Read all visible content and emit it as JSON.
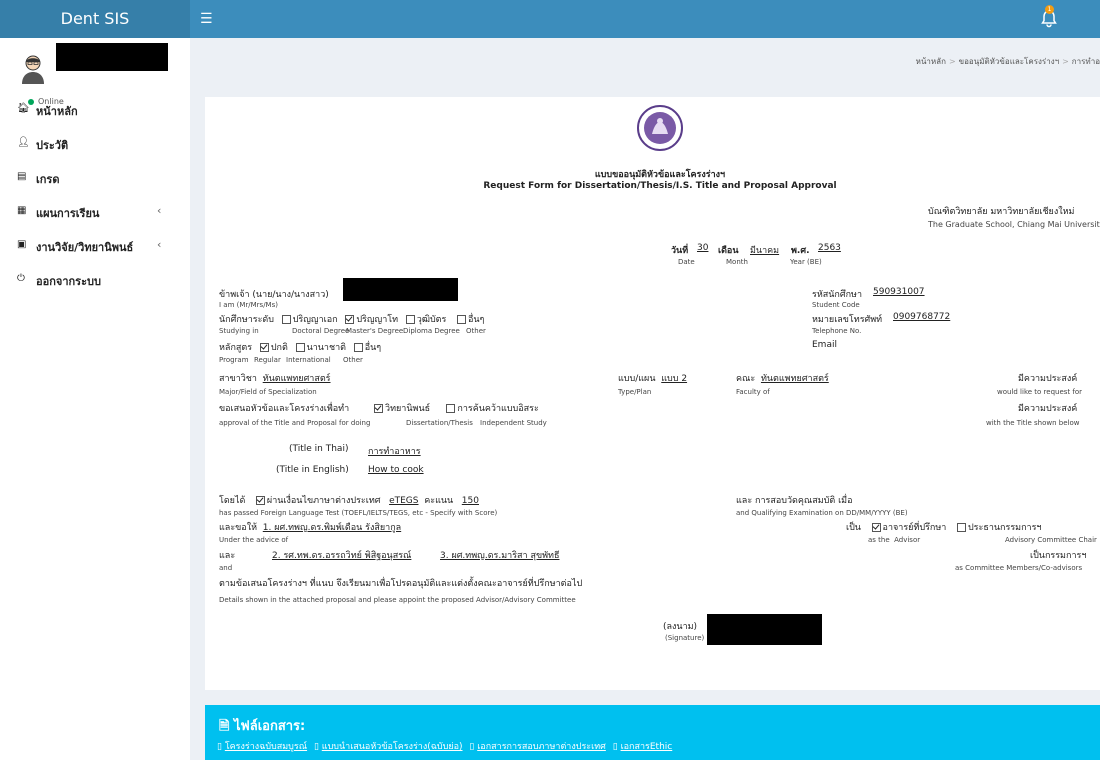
{
  "header": {
    "brand": "Dent SIS",
    "menu_icon": "menu-icon",
    "notification_count": "1"
  },
  "sidebar": {
    "status": "Online",
    "items": [
      {
        "icon": "home-icon",
        "label": "หน้าหลัก"
      },
      {
        "icon": "user-icon",
        "label": "ประวัติ"
      },
      {
        "icon": "grade-icon",
        "label": "เกรด"
      },
      {
        "icon": "calendar-icon",
        "label": "แผนการเรียน"
      },
      {
        "icon": "book-icon",
        "label": "งานวิจัย/วิทยานิพนธ์"
      },
      {
        "icon": "power-icon",
        "label": "ออกจากระบบ"
      }
    ]
  },
  "breadcrumb": {
    "home": "หน้าหลัก",
    "section": "ขออนุมัติหัวข้อและโครงร่างฯ",
    "current": "การทำอ"
  },
  "form": {
    "title_th": "แบบขออนุมัติหัวข้อและโครงร่างฯ",
    "title_en": "Request Form for Dissertation/Thesis/I.S. Title and Proposal Approval",
    "school_th": "บัณฑิตวิทยาลัย มหาวิทยาลัยเชียงใหม่",
    "school_en": "The Graduate School, Chiang Mai University",
    "date_lbl": "วันที่",
    "date_val": "30",
    "month_lbl": "เดือน",
    "month_val": "มีนาคม",
    "year_lbl": "พ.ศ.",
    "year_val": "2563",
    "date_en": "Date",
    "month_en": "Month",
    "year_en": "Year (BE)",
    "iam_th": "ข้าพเจ้า (นาย/นาง/นางสาว)",
    "iam_en": "I am (Mr/Mrs/Ms)",
    "student_code_th": "รหัสนักศึกษา",
    "student_code_val": "590931007",
    "student_code_en": "Student Code",
    "level_th": "นักศึกษาระดับ",
    "level_doc": "ปริญญาเอก",
    "level_master": "ปริญญาโท",
    "level_dip": "วุฒิบัตร",
    "level_other": "อื่นๆ",
    "level_en": "Studying in",
    "level_doc_en": "Doctoral Degree",
    "level_master_en": "Master's Degree",
    "level_dip_en": "Diploma Degree",
    "level_other_en": "Other",
    "phone_th": "หมายเลขโทรศัพท์",
    "phone_val": "0909768772",
    "phone_en": "Telephone No.",
    "email_en": "Email",
    "program_th": "หลักสูตร",
    "prog_regular": "ปกติ",
    "prog_inter": "นานาชาติ",
    "prog_other": "อื่นๆ",
    "program_en": "Program",
    "prog_regular_en": "Regular",
    "prog_inter_en": "International",
    "prog_other_en": "Other",
    "major_th": "สาขาวิชา",
    "major_val": "ทันตแพทยศาสตร์",
    "major_en": "Major/Field of Specialization",
    "plan_th": "แบบ/แผน",
    "plan_val": "แบบ 2",
    "plan_en": "Type/Plan",
    "faculty_th": "คณะ",
    "faculty_val": "ทันตแพทยศาสตร์",
    "faculty_en": "Faculty of",
    "wish_th": "มีความประสงค์",
    "wish_en": "would like to request for",
    "approve_th": "ขอเสนอหัวข้อและโครงร่างเพื่อทำ",
    "thesis_th": "วิทยานิพนธ์",
    "is_th": "การค้นคว้าแบบอิสระ",
    "approve_en": "approval of the Title and Proposal for doing",
    "thesis_en": "Dissertation/Thesis",
    "is_en": "Independent Study",
    "wish2_th": "มีความประสงค์",
    "wish2_en": "with the Title shown below",
    "title_thai_lbl": "(Title in Thai)",
    "title_thai_val": "การทำอาหาร",
    "title_eng_lbl": "(Title in English)",
    "title_eng_val": "How to cook",
    "by_th": "โดยได้",
    "passed_th": "ผ่านเงื่อนไขภาษาต่างประเทศ",
    "test_val": "eTEGS",
    "score_lbl": "คะแนน",
    "score_val": "150",
    "passed_en": "has passed Foreign Language Test (TOEFL/IELTS/TEGS, etc - Specify with Score)",
    "qual_th": "และ การสอบวัดคุณสมบัติ เมื่อ",
    "qual_en": "and Qualifying Examination on DD/MM/YYYY (BE)",
    "advice_th": "และขอให้",
    "advisor1": "1. ผศ.ทพญ.ดร.พิมพ์เดือน รังสิยากูล",
    "advice_en": "Under the advice of",
    "as_th": "เป็น",
    "role_advisor": "อาจารย์ที่ปรึกษา",
    "role_chair": "ประธานกรรมการฯ",
    "as_en": "as the",
    "role_advisor_en": "Advisor",
    "role_chair_en": "Advisory Committee Chair",
    "and_th": "และ",
    "advisor2": "2. รศ.ทพ.ดร.อรรถวิทย์ พิสิฐอนุสรณ์",
    "advisor3": "3. ผศ.ทพญ.ดร.มาริสา สุขพัทธี",
    "member_th": "เป็นกรรมการฯ",
    "and_en": "and",
    "member_en": "as Committee Members/Co-advisors",
    "details_th": "ตามข้อเสนอโครงร่างฯ ที่แนบ จึงเรียนมาเพื่อโปรดอนุมัติและแต่งตั้งคณะอาจารย์ที่ปรึกษาต่อไป",
    "details_en": "Details shown in the attached proposal and please appoint the proposed Advisor/Advisory Committee",
    "sign_th": "(ลงนาม)",
    "sign_en": "(Signature)"
  },
  "files": {
    "title": "ไฟล์เอกสาร:",
    "links": [
      "โครงร่างฉบับสมบูรณ์",
      "แบบนำเสนอหัวข้อโครงร่าง(ฉบับย่อ)",
      "เอกสารการสอบภาษาต่างประเทศ",
      "เอกสารEthic"
    ]
  }
}
